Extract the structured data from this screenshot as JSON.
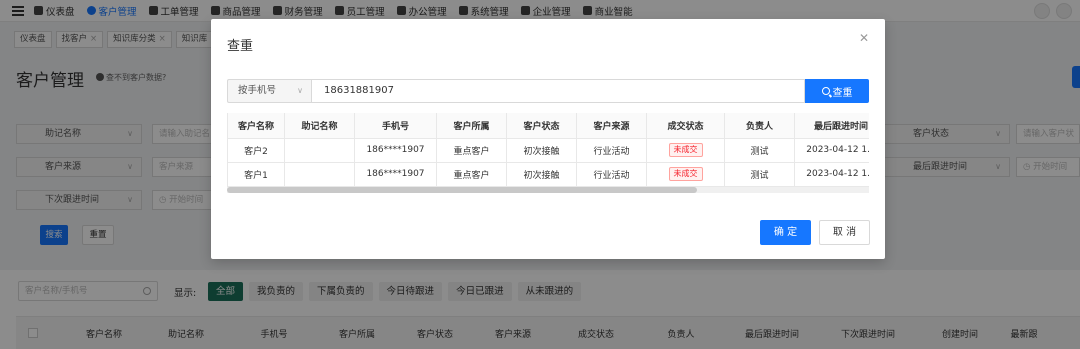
{
  "nav": {
    "items": [
      {
        "label": "仪表盘",
        "active": false
      },
      {
        "label": "客户管理",
        "active": true
      },
      {
        "label": "工单管理",
        "active": false
      },
      {
        "label": "商品管理",
        "active": false
      },
      {
        "label": "财务管理",
        "active": false
      },
      {
        "label": "员工管理",
        "active": false
      },
      {
        "label": "办公管理",
        "active": false
      },
      {
        "label": "系统管理",
        "active": false
      },
      {
        "label": "企业管理",
        "active": false
      },
      {
        "label": "商业智能",
        "active": false
      }
    ]
  },
  "tabs": [
    {
      "label": "仪表盘"
    },
    {
      "label": "找客户",
      "closable": true
    },
    {
      "label": "知识库分类",
      "closable": true
    },
    {
      "label": "知识库",
      "closable": true
    }
  ],
  "page": {
    "title": "客户管理",
    "hint": "查不到客户数据?"
  },
  "filters": {
    "row1": [
      {
        "select": "助记名称",
        "placeholder": "请输入助记名"
      },
      {
        "select": "客户状态",
        "placeholder": "请输入客户状"
      }
    ],
    "row2": [
      {
        "select": "客户来源",
        "placeholder": "客户来源"
      },
      {
        "select": "最后跟进时间",
        "placeholder": "开始时间"
      }
    ],
    "row3": [
      {
        "select": "下次跟进时间",
        "placeholder": "开始时间"
      }
    ],
    "search_label": "搜索",
    "reset_label": "重置"
  },
  "list_toolbar": {
    "keyword_placeholder": "客户名称/手机号",
    "show_label": "显示:",
    "chips": [
      {
        "label": "全部",
        "active": true
      },
      {
        "label": "我负责的",
        "active": false
      },
      {
        "label": "下属负责的",
        "active": false
      },
      {
        "label": "今日待跟进",
        "active": false
      },
      {
        "label": "今日已跟进",
        "active": false
      },
      {
        "label": "从未跟进的",
        "active": false
      }
    ]
  },
  "bg_table": {
    "columns": [
      "客户名称",
      "助记名称",
      "手机号",
      "客户所属",
      "客户状态",
      "客户来源",
      "成交状态",
      "负责人",
      "最后跟进时间",
      "下次跟进时间",
      "创建时间",
      "最新跟"
    ]
  },
  "modal": {
    "title": "查重",
    "close_icon": "close-icon",
    "search_type": "按手机号",
    "search_value": "18631881907",
    "search_button": "查重",
    "columns": [
      "客户名称",
      "助记名称",
      "手机号",
      "客户所属",
      "客户状态",
      "客户来源",
      "成交状态",
      "负责人",
      "最后跟进时间"
    ],
    "rows": [
      {
        "name": "客户2",
        "alias": "",
        "phone": "186****1907",
        "belong": "重点客户",
        "status": "初次接触",
        "source": "行业活动",
        "deal": "未成交",
        "owner": "测试",
        "last_follow": "2023-04-12 1..."
      },
      {
        "name": "客户1",
        "alias": "",
        "phone": "186****1907",
        "belong": "重点客户",
        "status": "初次接触",
        "source": "行业活动",
        "deal": "未成交",
        "owner": "测试",
        "last_follow": "2023-04-12 1..."
      }
    ],
    "ok_label": "确 定",
    "cancel_label": "取 消"
  },
  "colors": {
    "primary": "#1677ff",
    "chip_active": "#1a6f5a",
    "deal_badge": "#f5222d"
  }
}
